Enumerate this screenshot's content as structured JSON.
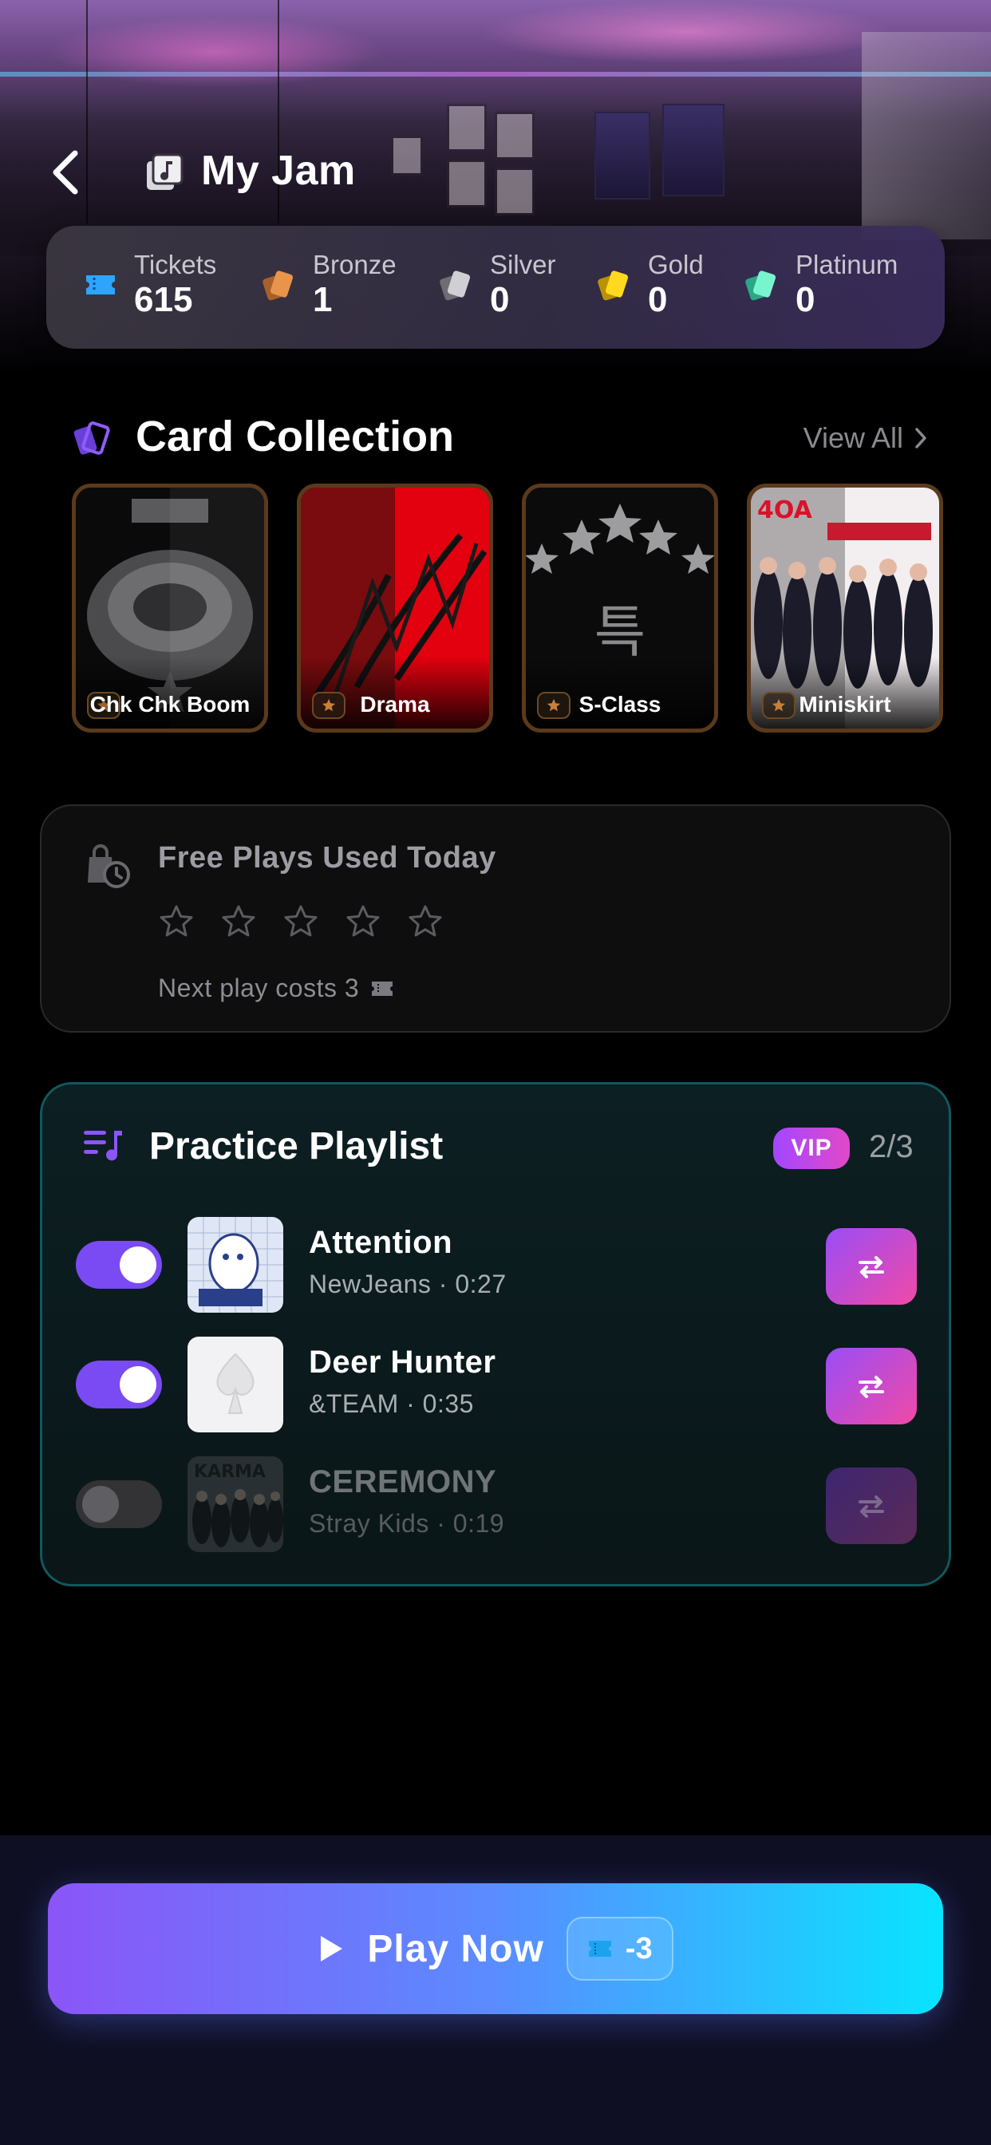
{
  "header": {
    "title": "My Jam"
  },
  "currency": [
    {
      "label": "Tickets",
      "value": "615",
      "icon": "ticket-icon",
      "color": "#2fa4ff"
    },
    {
      "label": "Bronze",
      "value": "1",
      "icon": "bronze-card-icon",
      "color": "#d9893a"
    },
    {
      "label": "Silver",
      "value": "0",
      "icon": "silver-card-icon",
      "color": "#c8c8cc"
    },
    {
      "label": "Gold",
      "value": "0",
      "icon": "gold-card-icon",
      "color": "#ffd21f"
    },
    {
      "label": "Platinum",
      "value": "0",
      "icon": "platinum-card-icon",
      "color": "#6ff0c8"
    }
  ],
  "collection": {
    "title": "Card Collection",
    "view_all": "View All",
    "cards": [
      {
        "name": "Chk Chk Boom"
      },
      {
        "name": "Drama"
      },
      {
        "name": "S-Class"
      },
      {
        "name": "Miniskirt"
      }
    ]
  },
  "free_plays": {
    "title": "Free Plays Used Today",
    "stars_total": 5,
    "stars_filled": 0,
    "next_cost": "Next play costs 3"
  },
  "playlist": {
    "title": "Practice Playlist",
    "badge": "VIP",
    "count": "2/3",
    "tracks": [
      {
        "title": "Attention",
        "subtitle": "NewJeans · 0:27",
        "enabled": true
      },
      {
        "title": "Deer Hunter",
        "subtitle": "&TEAM · 0:35",
        "enabled": true
      },
      {
        "title": "CEREMONY",
        "subtitle": "Stray Kids · 0:19",
        "enabled": false
      }
    ]
  },
  "play": {
    "label": "Play Now",
    "cost": "-3"
  },
  "colors": {
    "accent": "#7a4af2",
    "play_start": "#8b55f7",
    "play_end": "#08e4ff",
    "playlist_border": "#11585e"
  }
}
